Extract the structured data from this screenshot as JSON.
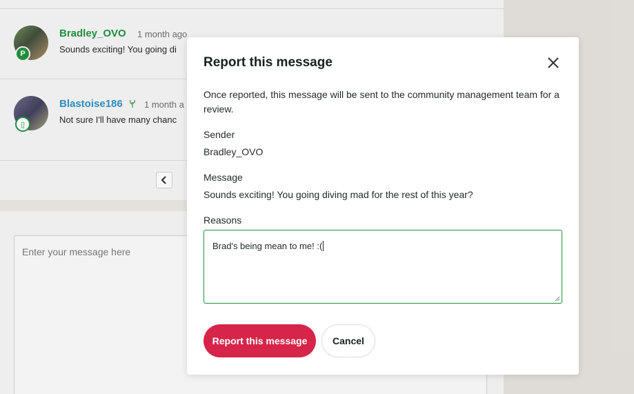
{
  "background": {
    "messages": [
      {
        "username": "Bradley_OVO",
        "time": "1 month ago",
        "text": "Sounds exciting! You going di",
        "badge": "P"
      },
      {
        "username": "Blastoise186",
        "time": "1 month a",
        "text": "Not sure I'll have many chanc",
        "badge": "▯"
      }
    ],
    "compose_placeholder": "Enter your message here"
  },
  "modal": {
    "title": "Report this message",
    "description": "Once reported, this message will be sent to the community management team for a review.",
    "sender_label": "Sender",
    "sender_value": "Bradley_OVO",
    "message_label": "Message",
    "message_value": "Sounds exciting! You going diving mad for the rest of this year?",
    "reasons_label": "Reasons",
    "reasons_value": "Brad's being mean to me! :(",
    "report_button": "Report this message",
    "cancel_button": "Cancel"
  },
  "colors": {
    "accent_green": "#1c8f3c",
    "report_red": "#d7244a",
    "username_blue": "#2a8fc0"
  }
}
